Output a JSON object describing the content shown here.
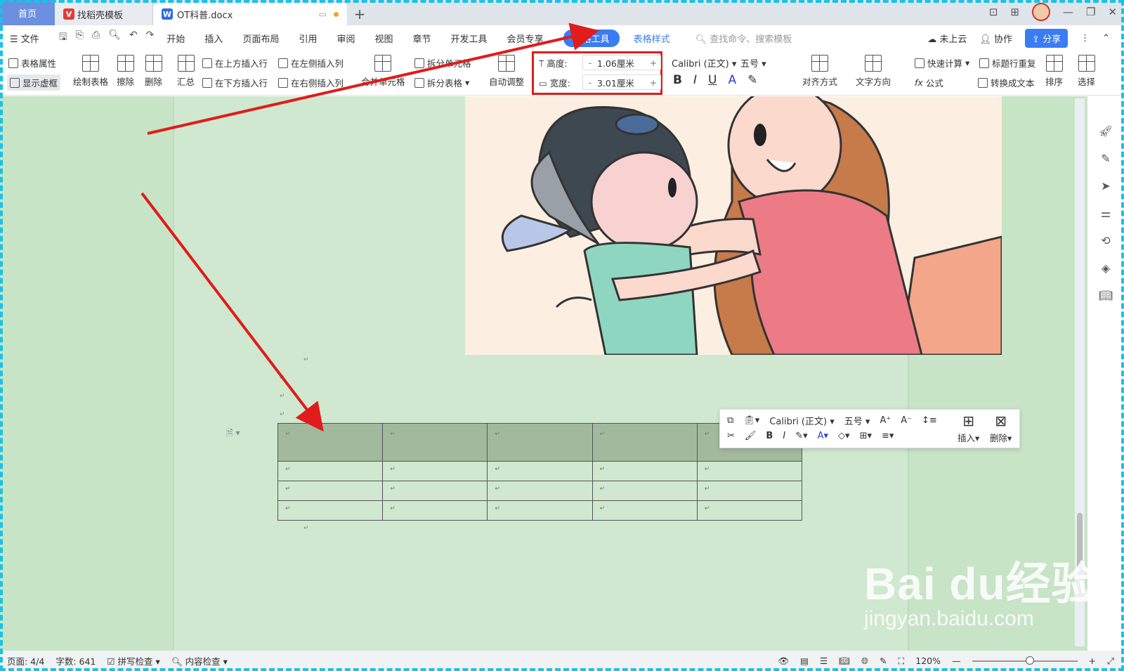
{
  "tabs": {
    "home": "首页",
    "templates": "找稻壳模板",
    "document": "OT科普.docx"
  },
  "menu": {
    "file": "文件",
    "items": [
      "开始",
      "插入",
      "页面布局",
      "引用",
      "审阅",
      "视图",
      "章节",
      "开发工具",
      "会员专享"
    ],
    "table_tools": "表格工具",
    "table_style": "表格样式",
    "search": "查找命令、搜索模板",
    "cloud": "未上云",
    "collab": "协作",
    "share": "分享"
  },
  "ribbon": {
    "table_props": "表格属性",
    "show_gridlines": "显示虚框",
    "draw_table": "绘制表格",
    "erase": "擦除",
    "delete": "删除",
    "summary": "汇总",
    "insert_above": "在上方插入行",
    "insert_below": "在下方插入行",
    "insert_left": "在左侧插入列",
    "insert_right": "在右侧插入列",
    "merge_cells": "合并单元格",
    "split_cells": "拆分单元格",
    "split_table": "拆分表格",
    "auto_fit": "自动调整",
    "height_label": "高度:",
    "height_value": "1.06厘米",
    "width_label": "宽度:",
    "width_value": "3.01厘米",
    "font_name": "Calibri (正文)",
    "font_size": "五号",
    "align": "对齐方式",
    "text_direction": "文字方向",
    "quick_calc": "快速计算",
    "repeat_header": "标题行重复",
    "formula": "公式",
    "convert_text": "转换成文本",
    "sort": "排序",
    "select": "选择"
  },
  "floatbar": {
    "font_name": "Calibri (正文)",
    "font_size": "五号",
    "insert": "插入",
    "delete": "删除"
  },
  "status": {
    "page": "页面: 4/4",
    "words": "字数: 641",
    "spell": "拼写检查",
    "content": "内容检查",
    "zoom": "120%"
  },
  "table": {
    "rows": 4,
    "cols": 5
  },
  "watermark": {
    "line1": "Bai du经验",
    "line2": "jingyan.baidu.com"
  },
  "colors": {
    "accent": "#3a7cf3",
    "highlight_box": "#e01c1c",
    "page_bg": "#cfe8cf",
    "header_row": "#a3b99e"
  }
}
